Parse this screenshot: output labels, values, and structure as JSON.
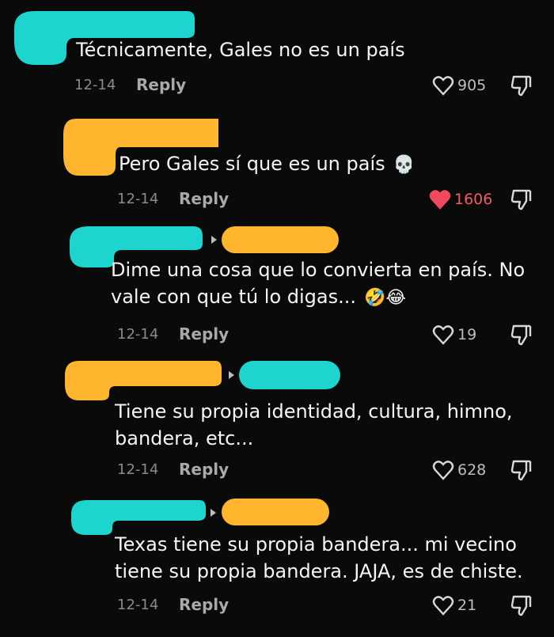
{
  "colors": {
    "cyan": "#1ed4cf",
    "orange": "#ffb52e",
    "liked": "#f2485e"
  },
  "comments": [
    {
      "text_lines": [
        "Técnicamente, Gales no es un país"
      ],
      "emoji": "",
      "date": "12-14",
      "reply_label": "Reply",
      "likes": "905",
      "liked": false
    },
    {
      "text_lines": [
        "Pero Gales sí que es un país"
      ],
      "emoji": "💀",
      "date": "12-14",
      "reply_label": "Reply",
      "likes": "1606",
      "liked": true
    },
    {
      "text_lines": [
        "Dime una cosa que lo convierta en país. No",
        "vale con que tú lo digas..."
      ],
      "emoji": "🤣😂",
      "date": "12-14",
      "reply_label": "Reply",
      "likes": "19",
      "liked": false
    },
    {
      "text_lines": [
        "Tiene su propia identidad, cultura, himno,",
        "bandera, etc..."
      ],
      "emoji": "",
      "date": "12-14",
      "reply_label": "Reply",
      "likes": "628",
      "liked": false
    },
    {
      "text_lines": [
        "Texas tiene su propia bandera... mi vecino",
        "tiene su propia bandera. JAJA, es de chiste."
      ],
      "emoji": "",
      "date": "12-14",
      "reply_label": "Reply",
      "likes": "21",
      "liked": false
    }
  ]
}
